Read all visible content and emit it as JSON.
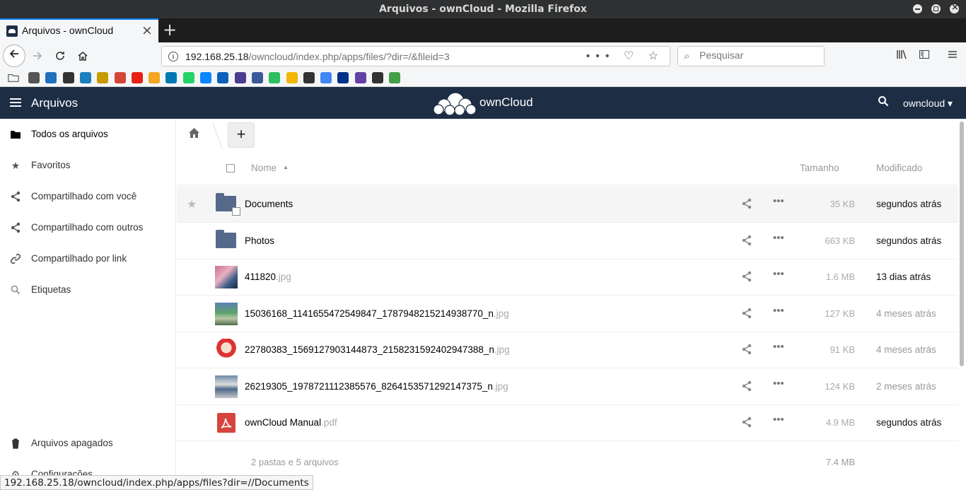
{
  "window": {
    "title": "Arquivos - ownCloud - Mozilla Firefox"
  },
  "browser": {
    "tab_title": "Arquivos - ownCloud",
    "tab_close": "×",
    "new_tab": "+",
    "url_host": "192.168.25.18",
    "url_path": "/owncloud/index.php/apps/files/?dir=/&fileid=3",
    "url_actions": "••• ♡ ☆",
    "search_placeholder": "Pesquisar",
    "bookmark_colors": [
      "#555",
      "#1e6fbf",
      "#333",
      "#1a7ebf",
      "#c79a00",
      "#d44638",
      "#e62117",
      "#f5a623",
      "#0077b5",
      "#25d366",
      "#0a84ff",
      "#0b61b9",
      "#4b3c8f",
      "#3b5998",
      "#2dbe60",
      "#f2b705",
      "#333",
      "#4285f4",
      "#003087",
      "#6441a4",
      "#333",
      "#43a047"
    ]
  },
  "header": {
    "app_name": "Arquivos",
    "logo_text": "ownCloud",
    "user": "owncloud ▾"
  },
  "sidebar": {
    "items": [
      {
        "label": "Todos os arquivos",
        "icon": "folder-icon"
      },
      {
        "label": "Favoritos",
        "icon": "star-icon"
      },
      {
        "label": "Compartilhado com você",
        "icon": "share-icon"
      },
      {
        "label": "Compartilhado com outros",
        "icon": "share-icon"
      },
      {
        "label": "Compartilhado por link",
        "icon": "link-icon"
      },
      {
        "label": "Etiquetas",
        "icon": "tag-search-icon"
      }
    ],
    "deleted": "Arquivos apagados",
    "settings": "Configurações"
  },
  "files": {
    "columns": {
      "name": "Nome",
      "size": "Tamanho",
      "modified": "Modificado"
    },
    "rows": [
      {
        "name": "Documents",
        "ext": "",
        "type": "folder",
        "size": "35 KB",
        "modified": "segundos atrás",
        "recent": true
      },
      {
        "name": "Photos",
        "ext": "",
        "type": "folder",
        "size": "663 KB",
        "modified": "segundos atrás",
        "recent": true
      },
      {
        "name": "411820",
        "ext": ".jpg",
        "type": "image",
        "size": "1.6 MB",
        "modified": "13 dias atrás",
        "recent": true
      },
      {
        "name": "15036168_1141655472549847_1787948215214938770_n",
        "ext": ".jpg",
        "type": "image",
        "size": "127 KB",
        "modified": "4 meses atrás",
        "recent": false
      },
      {
        "name": "22780383_1569127903144873_2158231592402947388_n",
        "ext": ".jpg",
        "type": "image",
        "size": "91 KB",
        "modified": "4 meses atrás",
        "recent": false
      },
      {
        "name": "26219305_1978721112385576_8264153571292147375_n",
        "ext": ".jpg",
        "type": "image",
        "size": "124 KB",
        "modified": "2 meses atrás",
        "recent": false
      },
      {
        "name": "ownCloud Manual",
        "ext": ".pdf",
        "type": "pdf",
        "size": "4.9 MB",
        "modified": "segundos atrás",
        "recent": true
      }
    ],
    "summary": "2 pastas e 5 arquivos",
    "summary_size": "7.4 MB"
  },
  "statusbar": "192.168.25.18/owncloud/index.php/apps/files?dir=//Documents"
}
